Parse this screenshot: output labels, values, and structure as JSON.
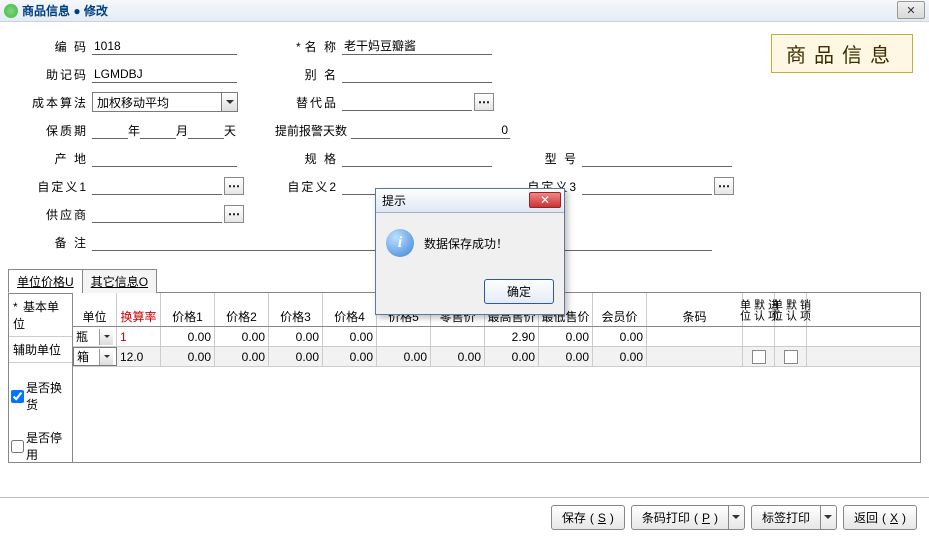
{
  "titlebar": {
    "title": "商品信息 ● 修改"
  },
  "badge": "商品信息",
  "form": {
    "code_label": "编  码",
    "code_value": "1018",
    "name_label": "名  称",
    "name_value": "老干妈豆瓣酱",
    "mnemonic_label": "助记码",
    "mnemonic_value": "LGMDBJ",
    "alias_label": "别  名",
    "alias_value": "",
    "cost_label": "成本算法",
    "cost_value": "加权移动平均",
    "subst_label": "替代品",
    "subst_value": "",
    "shelf_label": "保质期",
    "shelf_year": "",
    "shelf_month": "",
    "shelf_day": "",
    "year_lbl": "年",
    "month_lbl": "月",
    "day_lbl": "天",
    "warn_label": "提前报警天数",
    "warn_value": "0",
    "origin_label": "产  地",
    "origin_value": "",
    "spec_label": "规  格",
    "spec_value": "",
    "model_label": "型  号",
    "model_value": "",
    "cust1_label": "自定义1",
    "cust1_value": "",
    "cust2_label": "自定义2",
    "cust2_value": "",
    "cust3_label": "自定义3",
    "cust3_value": "",
    "supplier_label": "供应商",
    "supplier_value": "",
    "remark_label": "备  注",
    "remark_value": ""
  },
  "tabs": {
    "tab1": "单位价格",
    "tab1_hk": "U",
    "tab2": "其它信息",
    "tab2_hk": "O"
  },
  "grid": {
    "row_basic": "基本单位",
    "row_aux": "辅助单位",
    "chk_exchange": "是否换货",
    "chk_disable": "是否停用",
    "headers": {
      "unit": "单位",
      "rate": "换算率",
      "p1": "价格1",
      "p2": "价格2",
      "p3": "价格3",
      "p4": "价格4",
      "p5": "价格5",
      "retail": "零售价",
      "max": "最高售价",
      "min": "最低售价",
      "vip": "会员价",
      "barcode": "条码",
      "in_unit": "进项默认单位",
      "out_unit": "销项默认单位"
    },
    "r1": {
      "unit": "瓶",
      "rate": "1",
      "p1": "0.00",
      "p2": "0.00",
      "p3": "0.00",
      "p4": "0.00",
      "max": "2.90",
      "min": "0.00",
      "vip": "0.00",
      "barcode": ""
    },
    "r2": {
      "unit": "箱",
      "rate": "12.0",
      "p1": "0.00",
      "p2": "0.00",
      "p3": "0.00",
      "p4": "0.00",
      "p5": "0.00",
      "retail": "0.00",
      "max": "0.00",
      "min": "0.00",
      "vip": "0.00",
      "barcode": ""
    }
  },
  "footer": {
    "save": "保存",
    "save_hk": "S",
    "bprint": "条码打印",
    "bprint_hk": "P",
    "lprint": "标签打印",
    "back": "返回",
    "back_hk": "X"
  },
  "modal": {
    "title": "提示",
    "msg": "数据保存成功！",
    "ok": "确定"
  }
}
